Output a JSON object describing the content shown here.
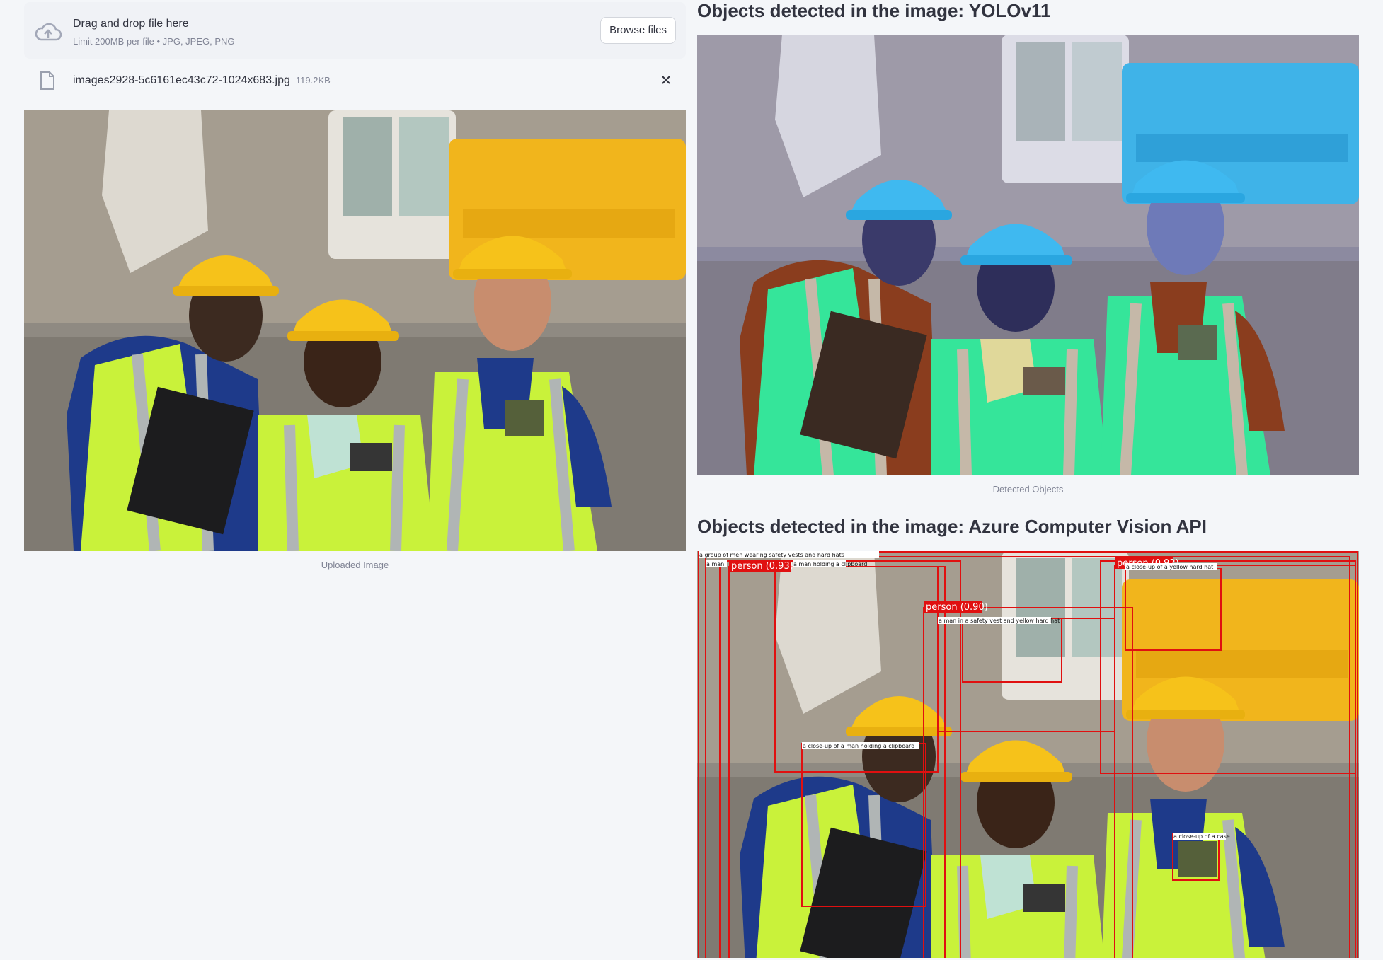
{
  "uploader": {
    "drag_text": "Drag and drop file here",
    "limit_text": "Limit 200MB per file • JPG, JPEG, PNG",
    "browse_label": "Browse files",
    "file_name": "images2928-5c6161ec43c72-1024x683.jpg",
    "file_size": "119.2KB"
  },
  "left": {
    "caption": "Uploaded Image"
  },
  "yolo": {
    "heading": "Objects detected in the image: YOLOv11",
    "caption": "Detected Objects"
  },
  "azure": {
    "heading": "Objects detected in the image: Azure Computer Vision API",
    "labels": {
      "person1": "person (0.93)",
      "person2": "person (0.90)",
      "person3": "person (0.92)",
      "group": "a group of men wearing safety vests and hard hats",
      "man_a": "a man",
      "clipboard_cap": "a man holding a clipboard",
      "yellow_hat": "a man in a safety vest and yellow hard hat",
      "hat_closeup": "a close-up of a yellow hard hat",
      "closeup_clip": "a close-up of a man holding a clipboard",
      "case": "a close-up of a case"
    }
  },
  "colors": {
    "accent": "#31333f",
    "box": "#e01010",
    "hat_yellow": "#f6c21a",
    "hat_blue": "#3fb9f0",
    "vest_green": "#cff43a",
    "vest_green_yolo": "#35e59a"
  }
}
